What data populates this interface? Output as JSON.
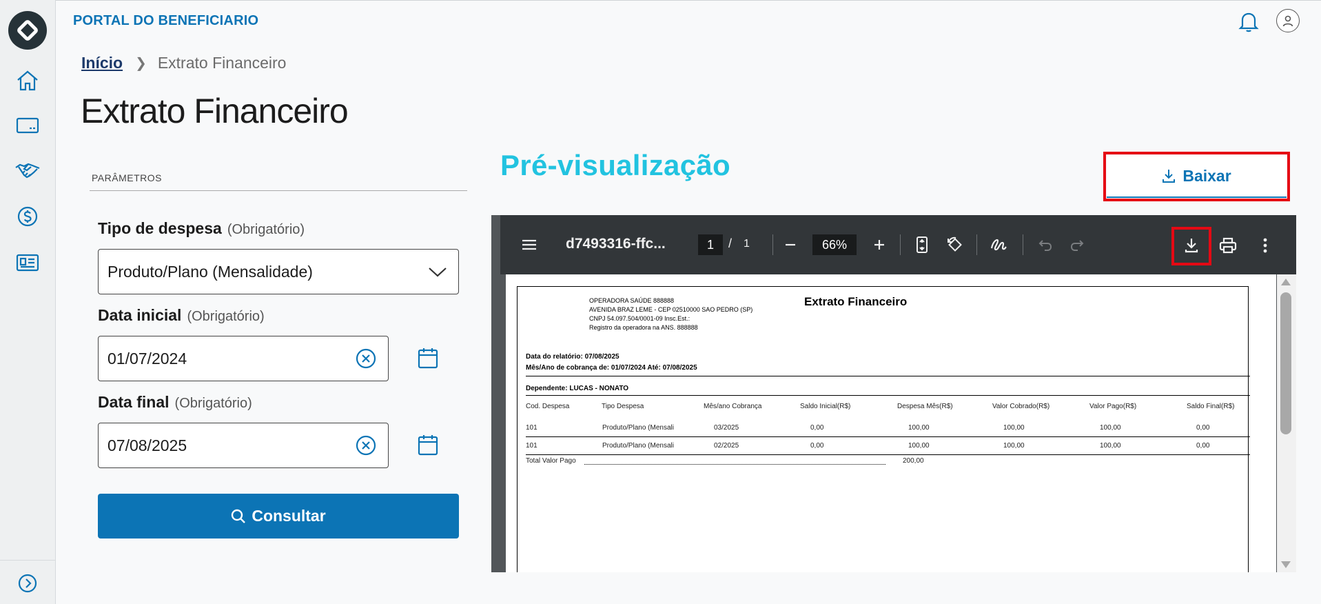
{
  "app": {
    "title": "PORTAL DO BENEFICIARIO"
  },
  "sidebar": {
    "items": [
      {
        "icon": "home-icon"
      },
      {
        "icon": "card-icon"
      },
      {
        "icon": "handshake-icon"
      },
      {
        "icon": "dollar-icon"
      },
      {
        "icon": "document-list-icon"
      }
    ],
    "expand_icon": "chevron-right-circle-icon"
  },
  "breadcrumb": {
    "home": "Início",
    "current": "Extrato Financeiro"
  },
  "page": {
    "title": "Extrato Financeiro"
  },
  "params": {
    "section_label": "PARÂMETROS",
    "tipo": {
      "label": "Tipo de despesa",
      "required": "(Obrigatório)",
      "value": "Produto/Plano (Mensalidade)"
    },
    "data_inicial": {
      "label": "Data inicial",
      "required": "(Obrigatório)",
      "value": "01/07/2024"
    },
    "data_final": {
      "label": "Data final",
      "required": "(Obrigatório)",
      "value": "07/08/2025"
    },
    "consultar_label": "Consultar"
  },
  "preview": {
    "title": "Pré-visualização",
    "baixar_label": "Baixar",
    "highlight_color": "#e50914"
  },
  "pdf_viewer": {
    "filename": "d7493316-ffc...",
    "page": "1",
    "page_sep": "/",
    "total_pages": "1",
    "zoom": "66%"
  },
  "document": {
    "operator_lines": [
      "OPERADORA SAÚDE 888888",
      "AVENIDA BRAZ LEME - CEP 02510000 SAO PEDRO (SP)",
      "CNPJ 54.097.504/0001-09  Insc.Est.:",
      "Registro da operadora na ANS. 888888"
    ],
    "title": "Extrato Financeiro",
    "report_date": "Data do relatório: 07/08/2025",
    "period": "Mês/Ano de cobrança de: 01/07/2024 Até: 07/08/2025",
    "dependent": "Dependente: LUCAS - NONATO",
    "columns": [
      "Cod. Despesa",
      "Tipo Despesa",
      "Mês/ano Cobrança",
      "Saldo Inicial(R$)",
      "Despesa Mês(R$)",
      "Valor Cobrado(R$)",
      "Valor Pago(R$)",
      "Saldo Final(R$)"
    ],
    "rows": [
      [
        "101",
        "Produto/Plano (Mensali",
        "03/2025",
        "0,00",
        "100,00",
        "100,00",
        "100,00",
        "0,00"
      ],
      [
        "101",
        "Produto/Plano (Mensali",
        "02/2025",
        "0,00",
        "100,00",
        "100,00",
        "100,00",
        "0,00"
      ]
    ],
    "total_label": "Total Valor Pago",
    "total_value": "200,00"
  }
}
